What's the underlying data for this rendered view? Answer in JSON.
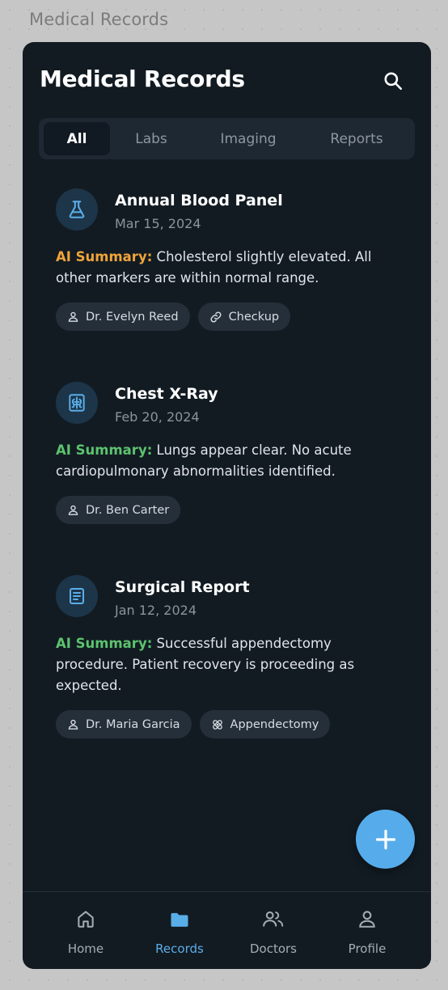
{
  "frame_label": "Medical Records",
  "header": {
    "title": "Medical Records",
    "search_icon": "search-icon"
  },
  "tabs": [
    {
      "label": "All",
      "active": true
    },
    {
      "label": "Labs",
      "active": false
    },
    {
      "label": "Imaging",
      "active": false
    },
    {
      "label": "Reports",
      "active": false
    }
  ],
  "records": [
    {
      "icon": "flask-icon",
      "title": "Annual Blood Panel",
      "date": "Mar 15, 2024",
      "summary_label": "AI Summary:",
      "summary_label_color": "#f0a43a",
      "summary_text": " Cholesterol slightly elevated. All other markers are within normal range.",
      "chips": [
        {
          "icon": "person-icon",
          "label": "Dr. Evelyn Reed"
        },
        {
          "icon": "link-icon",
          "label": "Checkup"
        }
      ]
    },
    {
      "icon": "xray-icon",
      "title": "Chest X-Ray",
      "date": "Feb 20, 2024",
      "summary_label": "AI Summary:",
      "summary_label_color": "#5cc36e",
      "summary_text": " Lungs appear clear. No acute cardiopulmonary abnormalities identified.",
      "chips": [
        {
          "icon": "person-icon",
          "label": "Dr. Ben Carter"
        }
      ]
    },
    {
      "icon": "document-icon",
      "title": "Surgical Report",
      "date": "Jan 12, 2024",
      "summary_label": "AI Summary:",
      "summary_label_color": "#5cc36e",
      "summary_text": " Successful appendectomy procedure. Patient recovery is proceeding as expected.",
      "chips": [
        {
          "icon": "person-icon",
          "label": "Dr. Maria Garcia"
        },
        {
          "icon": "bandage-icon",
          "label": "Appendectomy"
        }
      ]
    }
  ],
  "fab_icon": "plus-icon",
  "bottom_nav": [
    {
      "label": "Home",
      "icon": "home-icon",
      "active": false
    },
    {
      "label": "Records",
      "icon": "folder-icon",
      "active": true
    },
    {
      "label": "Doctors",
      "icon": "people-icon",
      "active": false
    },
    {
      "label": "Profile",
      "icon": "person-icon",
      "active": false
    }
  ],
  "colors": {
    "accent": "#56aceb",
    "background": "#121b22",
    "surface": "#1e2833",
    "chip": "#252f3a",
    "summary_orange": "#f0a43a",
    "summary_green": "#5cc36e"
  }
}
